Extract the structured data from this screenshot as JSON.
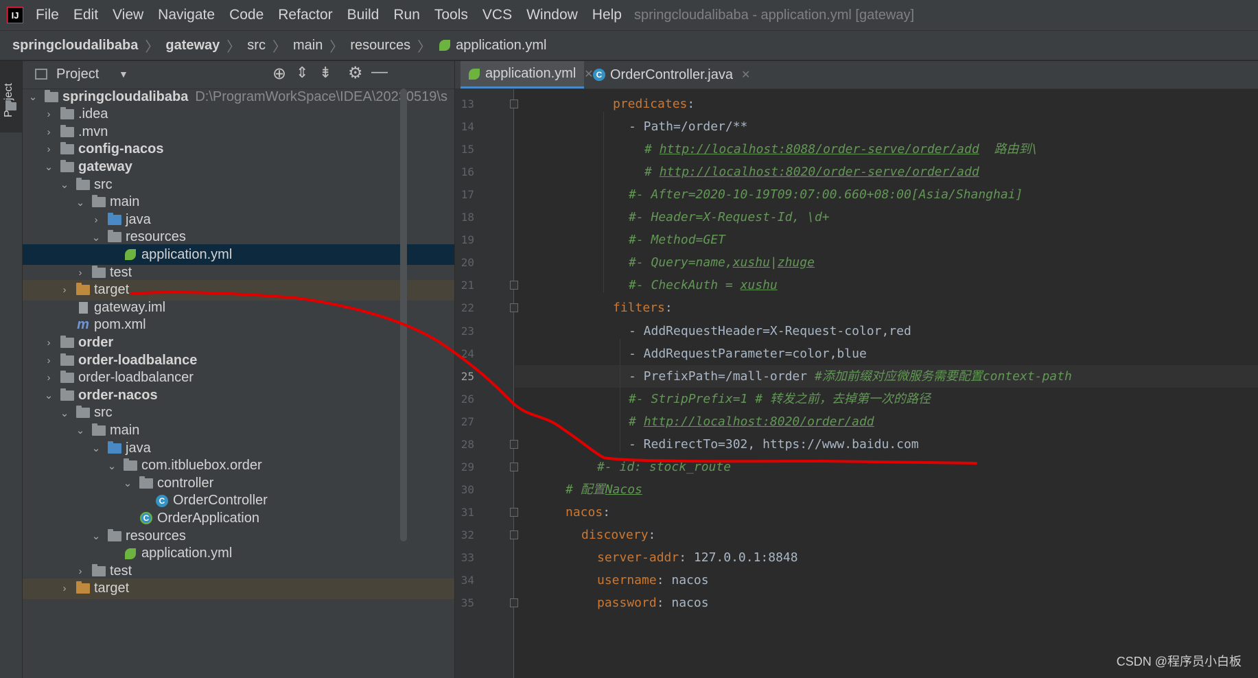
{
  "menu": {
    "items": [
      "File",
      "Edit",
      "View",
      "Navigate",
      "Code",
      "Refactor",
      "Build",
      "Run",
      "Tools",
      "VCS",
      "Window",
      "Help"
    ],
    "window_title": "springcloudalibaba - application.yml [gateway]"
  },
  "breadcrumb": [
    "springcloudalibaba",
    "gateway",
    "src",
    "main",
    "resources",
    "application.yml"
  ],
  "project_panel": {
    "title": "Project",
    "tool_window_label": "Project",
    "tree": [
      {
        "depth": 0,
        "expanded": true,
        "icon": "module-folder-icon",
        "name": "springcloudalibaba",
        "bold": true,
        "path": "D:\\ProgramWorkSpace\\IDEA\\20230519\\s"
      },
      {
        "depth": 1,
        "expanded": false,
        "icon": "folder-icon",
        "name": ".idea"
      },
      {
        "depth": 1,
        "expanded": false,
        "icon": "folder-icon",
        "name": ".mvn"
      },
      {
        "depth": 1,
        "expanded": false,
        "icon": "module-folder-icon",
        "name": "config-nacos",
        "bold": true
      },
      {
        "depth": 1,
        "expanded": true,
        "icon": "module-folder-icon",
        "name": "gateway",
        "bold": true
      },
      {
        "depth": 2,
        "expanded": true,
        "icon": "folder-icon",
        "name": "src"
      },
      {
        "depth": 3,
        "expanded": true,
        "icon": "folder-icon",
        "name": "main"
      },
      {
        "depth": 4,
        "expanded": false,
        "icon": "source-folder-icon",
        "name": "java"
      },
      {
        "depth": 4,
        "expanded": true,
        "icon": "resources-folder-icon",
        "name": "resources"
      },
      {
        "depth": 5,
        "icon": "spring-yml-icon",
        "name": "application.yml",
        "selected": true
      },
      {
        "depth": 3,
        "expanded": false,
        "icon": "folder-icon",
        "name": "test"
      },
      {
        "depth": 2,
        "expanded": false,
        "icon": "excluded-folder-icon",
        "name": "target",
        "excluded": true
      },
      {
        "depth": 2,
        "icon": "iml-file-icon",
        "name": "gateway.iml"
      },
      {
        "depth": 2,
        "icon": "maven-icon",
        "name": "pom.xml"
      },
      {
        "depth": 1,
        "expanded": false,
        "icon": "module-folder-icon",
        "name": "order",
        "bold": true
      },
      {
        "depth": 1,
        "expanded": false,
        "icon": "module-folder-icon",
        "name": "order-loadbalance",
        "bold": true
      },
      {
        "depth": 1,
        "expanded": false,
        "icon": "folder-icon",
        "name": "order-loadbalancer"
      },
      {
        "depth": 1,
        "expanded": true,
        "icon": "module-folder-icon",
        "name": "order-nacos",
        "bold": true
      },
      {
        "depth": 2,
        "expanded": true,
        "icon": "folder-icon",
        "name": "src"
      },
      {
        "depth": 3,
        "expanded": true,
        "icon": "folder-icon",
        "name": "main"
      },
      {
        "depth": 4,
        "expanded": true,
        "icon": "source-folder-icon",
        "name": "java"
      },
      {
        "depth": 5,
        "expanded": true,
        "icon": "package-icon",
        "name": "com.itbluebox.order"
      },
      {
        "depth": 6,
        "expanded": true,
        "icon": "package-icon",
        "name": "controller"
      },
      {
        "depth": 7,
        "icon": "class-icon",
        "name": "OrderController"
      },
      {
        "depth": 6,
        "icon": "spring-boot-class-icon",
        "name": "OrderApplication"
      },
      {
        "depth": 4,
        "expanded": true,
        "icon": "resources-folder-icon",
        "name": "resources"
      },
      {
        "depth": 5,
        "icon": "spring-yml-icon",
        "name": "application.yml"
      },
      {
        "depth": 3,
        "expanded": false,
        "icon": "folder-icon",
        "name": "test"
      },
      {
        "depth": 2,
        "expanded": false,
        "icon": "excluded-folder-icon",
        "name": "target",
        "excluded": true
      }
    ]
  },
  "editor": {
    "tabs": [
      {
        "label": "application.yml",
        "icon": "spring-yml-icon",
        "active": true
      },
      {
        "label": "OrderController.java",
        "icon": "class-icon",
        "active": false
      }
    ],
    "current_line": 25,
    "lines": [
      {
        "n": 13,
        "indent": 6,
        "tokens": [
          {
            "t": "predicates",
            "c": "k"
          },
          {
            "t": ":",
            "c": "v"
          }
        ]
      },
      {
        "n": 14,
        "indent": 8,
        "tokens": [
          {
            "t": "- Path=/order/**",
            "c": "v"
          }
        ]
      },
      {
        "n": 15,
        "indent": 10,
        "tokens": [
          {
            "t": "# ",
            "c": "c"
          },
          {
            "t": "http://localhost:8088/order-serve/order/add",
            "c": "c u"
          },
          {
            "t": "  路由到\\",
            "c": "c"
          }
        ]
      },
      {
        "n": 16,
        "indent": 10,
        "tokens": [
          {
            "t": "# ",
            "c": "c"
          },
          {
            "t": "http://localhost:8020/order-serve/order/add",
            "c": "c u"
          }
        ]
      },
      {
        "n": 17,
        "indent": 8,
        "tokens": [
          {
            "t": "#- After=2020-10-19T09:07:00.660+08:00[Asia/Shanghai]",
            "c": "c"
          }
        ]
      },
      {
        "n": 18,
        "indent": 8,
        "tokens": [
          {
            "t": "#- Header=X-Request-Id, \\d+",
            "c": "c"
          }
        ]
      },
      {
        "n": 19,
        "indent": 8,
        "tokens": [
          {
            "t": "#- Method=GET",
            "c": "c"
          }
        ]
      },
      {
        "n": 20,
        "indent": 8,
        "tokens": [
          {
            "t": "#- Query=name,",
            "c": "c"
          },
          {
            "t": "xushu",
            "c": "c u"
          },
          {
            "t": "|",
            "c": "c"
          },
          {
            "t": "zhuge",
            "c": "c u"
          }
        ]
      },
      {
        "n": 21,
        "indent": 8,
        "tokens": [
          {
            "t": "#- CheckAuth = ",
            "c": "c"
          },
          {
            "t": "xushu",
            "c": "c u"
          }
        ]
      },
      {
        "n": 22,
        "indent": 6,
        "tokens": [
          {
            "t": "filters",
            "c": "k"
          },
          {
            "t": ":",
            "c": "v"
          }
        ]
      },
      {
        "n": 23,
        "indent": 8,
        "tokens": [
          {
            "t": "- AddRequestHeader=X-Request-color,red",
            "c": "v"
          }
        ]
      },
      {
        "n": 24,
        "indent": 8,
        "tokens": [
          {
            "t": "- AddRequestParameter=color,blue",
            "c": "v"
          }
        ]
      },
      {
        "n": 25,
        "indent": 8,
        "tokens": [
          {
            "t": "- PrefixPath=/mall-order ",
            "c": "v"
          },
          {
            "t": "#添加前缀对应微服务需要配置context-path",
            "c": "c"
          }
        ]
      },
      {
        "n": 26,
        "indent": 8,
        "tokens": [
          {
            "t": "#- StripPrefix=1 # 转发之前，去掉第一次的路径",
            "c": "c"
          }
        ]
      },
      {
        "n": 27,
        "indent": 8,
        "tokens": [
          {
            "t": "# ",
            "c": "c"
          },
          {
            "t": "http://localhost:8020/order/add",
            "c": "c u"
          }
        ]
      },
      {
        "n": 28,
        "indent": 8,
        "tokens": [
          {
            "t": "- RedirectTo=302, https://www.baidu.com",
            "c": "v"
          }
        ]
      },
      {
        "n": 29,
        "indent": 4,
        "tokens": [
          {
            "t": "#- id: stock_route",
            "c": "c"
          }
        ]
      },
      {
        "n": 30,
        "indent": 0,
        "tokens": [
          {
            "t": "# 配置",
            "c": "c"
          },
          {
            "t": "Nacos",
            "c": "c u"
          }
        ]
      },
      {
        "n": 31,
        "indent": 0,
        "tokens": [
          {
            "t": "nacos",
            "c": "k"
          },
          {
            "t": ":",
            "c": "v"
          }
        ]
      },
      {
        "n": 32,
        "indent": 2,
        "tokens": [
          {
            "t": "discovery",
            "c": "k"
          },
          {
            "t": ":",
            "c": "v"
          }
        ]
      },
      {
        "n": 33,
        "indent": 4,
        "tokens": [
          {
            "t": "server-addr",
            "c": "k"
          },
          {
            "t": ": 127.0.0.1:8848",
            "c": "v"
          }
        ]
      },
      {
        "n": 34,
        "indent": 4,
        "tokens": [
          {
            "t": "username",
            "c": "k"
          },
          {
            "t": ": nacos",
            "c": "v"
          }
        ]
      },
      {
        "n": 35,
        "indent": 4,
        "tokens": [
          {
            "t": "password",
            "c": "k"
          },
          {
            "t": ": nacos",
            "c": "v"
          }
        ]
      }
    ]
  },
  "watermark": "CSDN @程序员小白板",
  "colors": {
    "annotation_stroke": "#e00000",
    "selection": "#0d293e",
    "keyword": "#cc7832",
    "comment": "#629755"
  }
}
